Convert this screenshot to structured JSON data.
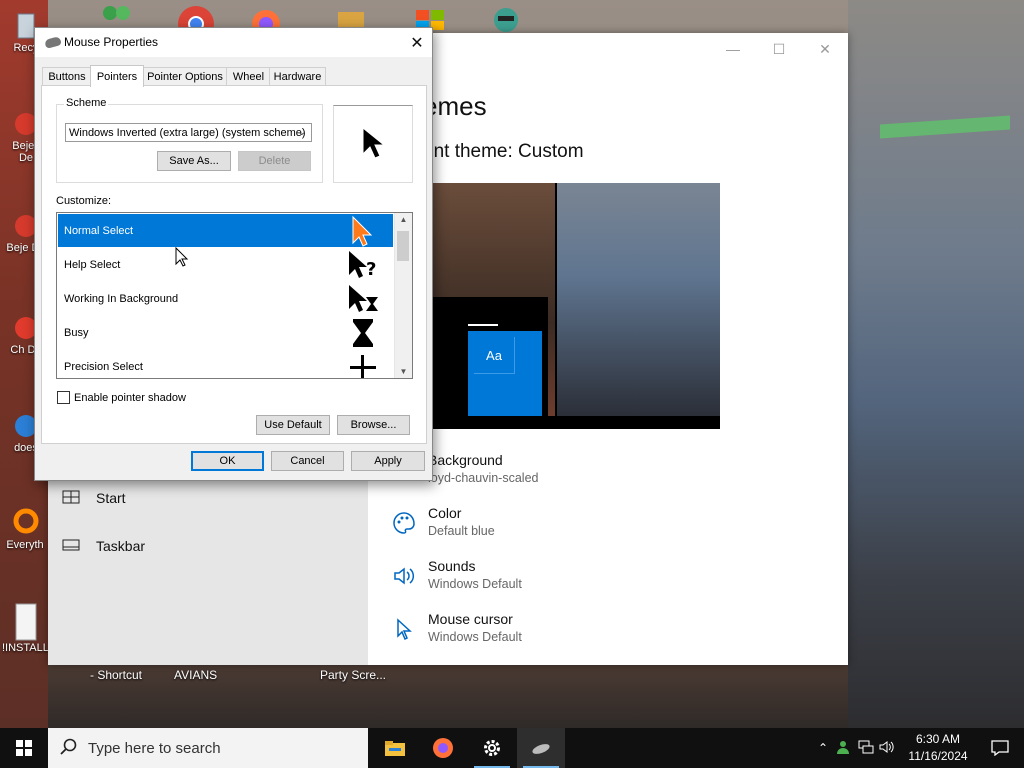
{
  "desktop": {
    "icons": [
      {
        "label": "Recy"
      },
      {
        "label": "Bejev De"
      },
      {
        "label": "Beje De"
      },
      {
        "label": "Ch De"
      },
      {
        "label": "does"
      },
      {
        "label": "Everyth"
      },
      {
        "label": "!INSTALL"
      }
    ],
    "bottom_labels": [
      "- Shortcut",
      "AVIANS",
      "Party Scre..."
    ]
  },
  "settings": {
    "title": "emes",
    "current_theme": "ent theme: Custom",
    "preview_tile": "Aa",
    "left_items": [
      {
        "label": "Start",
        "icon": "start-icon"
      },
      {
        "label": "Taskbar",
        "icon": "taskbar-icon"
      }
    ],
    "rows": [
      {
        "title": "Background",
        "value": "loyd-chauvin-scaled",
        "icon": "picture-icon"
      },
      {
        "title": "Color",
        "value": "Default blue",
        "icon": "palette-icon"
      },
      {
        "title": "Sounds",
        "value": "Windows Default",
        "icon": "speaker-icon"
      },
      {
        "title": "Mouse cursor",
        "value": "Windows Default",
        "icon": "cursor-icon"
      }
    ]
  },
  "dialog": {
    "title": "Mouse Properties",
    "tabs": [
      "Buttons",
      "Pointers",
      "Pointer Options",
      "Wheel",
      "Hardware"
    ],
    "active_tab": "Pointers",
    "scheme_label": "Scheme",
    "scheme_value": "Windows Inverted (extra large) (system scheme)",
    "save_as": "Save As...",
    "delete": "Delete",
    "customize_label": "Customize:",
    "pointers": [
      {
        "label": "Normal Select",
        "icon": "arrow-cursor-icon",
        "selected": true
      },
      {
        "label": "Help Select",
        "icon": "help-cursor-icon",
        "selected": false
      },
      {
        "label": "Working In Background",
        "icon": "working-cursor-icon",
        "selected": false
      },
      {
        "label": "Busy",
        "icon": "hourglass-icon",
        "selected": false
      },
      {
        "label": "Precision Select",
        "icon": "crosshair-icon",
        "selected": false
      }
    ],
    "enable_shadow": "Enable pointer shadow",
    "use_default": "Use Default",
    "browse": "Browse...",
    "ok": "OK",
    "cancel": "Cancel",
    "apply": "Apply"
  },
  "taskbar": {
    "search_placeholder": "Type here to search",
    "time": "6:30 AM",
    "date": "11/16/2024",
    "apps": [
      "file-explorer-icon",
      "firefox-icon",
      "settings-gear-icon",
      "mouse-icon"
    ]
  },
  "colors": {
    "accent": "#0078d7",
    "selection": "#0078d7"
  }
}
